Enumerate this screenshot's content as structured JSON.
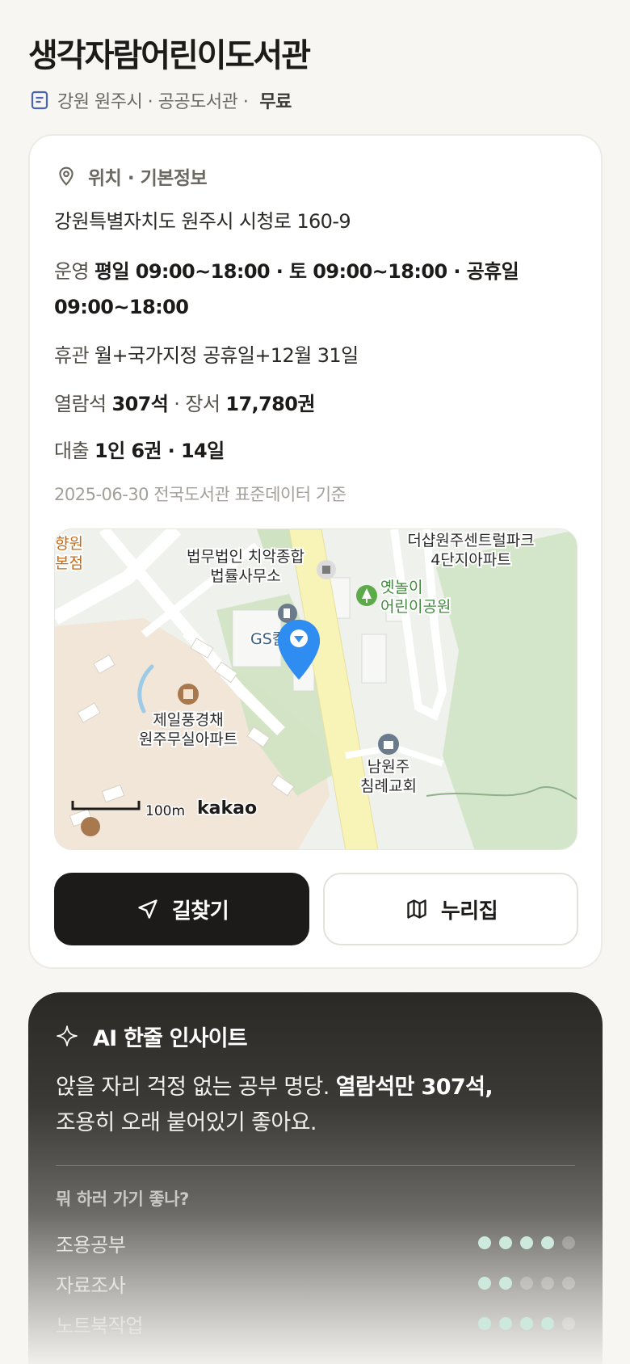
{
  "header": {
    "title": "생각자람어린이도서관",
    "meta_region": "강원 원주시 · 공공도서관 ·",
    "meta_fee": "무료"
  },
  "info": {
    "section_title": "위치 · 기본정보",
    "address": "강원특별자치도 원주시 시청로 160-9",
    "hours_label": "운영",
    "hours_value": "평일 09:00~18:00 · 토 09:00~18:00 · 공휴일 09:00~18:00",
    "closed_label": "휴관",
    "closed_value": "월+국가지정 공휴일+12월 31일",
    "seats_label": "열람석",
    "seats_value": "307석",
    "books_sep": "· 장서",
    "books_value": "17,780권",
    "loan_label": "대출",
    "loan_value": "1인 6권 · 14일",
    "data_note": "2025-06-30 전국도서관 표준데이터 기준"
  },
  "map": {
    "labels": {
      "law_office_1": "법무법인 치악종합",
      "law_office_2": "법률사무소",
      "apt_top_1": "더샵원주센트럴파크",
      "apt_top_2": "4단지아파트",
      "park_1": "옛놀이",
      "park_2": "어린이공원",
      "gs": "GS칼텍스",
      "apt_left_1": "제일풍경채",
      "apt_left_2": "원주무실아파트",
      "church_1": "남원주",
      "church_2": "침례교회",
      "edge_1": "향원",
      "edge_2": "본점",
      "scale": "100m",
      "brand": "kakao"
    }
  },
  "actions": {
    "directions_label": "길찾기",
    "nurizip_label": "누리집"
  },
  "ai": {
    "title": "AI 한줄 인사이트",
    "text_plain": "앉을 자리 걱정 없는 공부 명당.",
    "text_bold": "열람석만 307석,",
    "text_line2": "조용히 오래 붙어있기 좋아요.",
    "subhead": "뭐 하러 가기 좋나?",
    "scores": [
      {
        "name": "조용공부",
        "value": 4,
        "max": 5
      },
      {
        "name": "자료조사",
        "value": 2,
        "max": 5
      },
      {
        "name": "노트북작업",
        "value": 4,
        "max": 5
      }
    ]
  },
  "colors": {
    "accent_dark": "#1c1b19",
    "map_pin": "#2f8cf0",
    "dot_on": "#cde9de"
  }
}
